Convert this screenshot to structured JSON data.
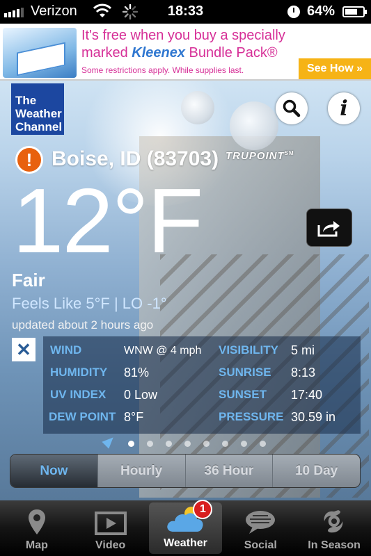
{
  "status_bar": {
    "carrier": "Verizon",
    "time": "18:33",
    "battery_percent": "64%",
    "battery_level": 0.64
  },
  "ad": {
    "line1": "It's free when you buy a specially",
    "line2_prefix": "marked",
    "brand": "Kleenex",
    "line2_suffix": "Bundle Pack®",
    "line3": "Some restrictions apply. While supplies last.",
    "cta": "See How »"
  },
  "header": {
    "logo_lines": [
      "The",
      "Weather",
      "Channel"
    ],
    "search_icon": "search-icon",
    "info_label": "i"
  },
  "location": {
    "alert_symbol": "!",
    "name": "Boise, ID (83703)",
    "trupoint": "TRUPOINT",
    "trupoint_mark": "SM"
  },
  "current": {
    "temperature": "12°F",
    "condition": "Fair",
    "feels_like": "Feels Like 5°F |  LO -1°",
    "updated": "updated about 2 hours ago"
  },
  "details": {
    "close_symbol": "✕",
    "rows": [
      {
        "l1": "WIND",
        "v1": "WNW @ 4 mph",
        "l2": "VISIBILITY",
        "v2": "5 mi"
      },
      {
        "l1": "HUMIDITY",
        "v1": "81%",
        "l2": "SUNRISE",
        "v2": "8:13"
      },
      {
        "l1": "UV INDEX",
        "v1": "0 Low",
        "l2": "SUNSET",
        "v2": "17:40"
      },
      {
        "l1": "DEW POINT",
        "v1": "8°F",
        "l2": "PRESSURE",
        "v2": "30.59 in"
      }
    ]
  },
  "page_dots": {
    "count": 8,
    "active": 0
  },
  "segments": [
    "Now",
    "Hourly",
    "36 Hour",
    "10 Day"
  ],
  "tabs": [
    {
      "label": "Map",
      "icon": "map-pin-icon"
    },
    {
      "label": "Video",
      "icon": "video-icon"
    },
    {
      "label": "Weather",
      "icon": "weather-cloud-icon",
      "badge": "1"
    },
    {
      "label": "Social",
      "icon": "social-icon"
    },
    {
      "label": "In Season",
      "icon": "hurricane-icon"
    }
  ],
  "colors": {
    "accent_blue": "#6fb6ee",
    "alert_orange": "#e8610e",
    "ad_pink": "#d62f97",
    "ad_cta": "#f6b316",
    "logo_blue": "#1c47a0",
    "badge_red": "#d81f1f"
  }
}
